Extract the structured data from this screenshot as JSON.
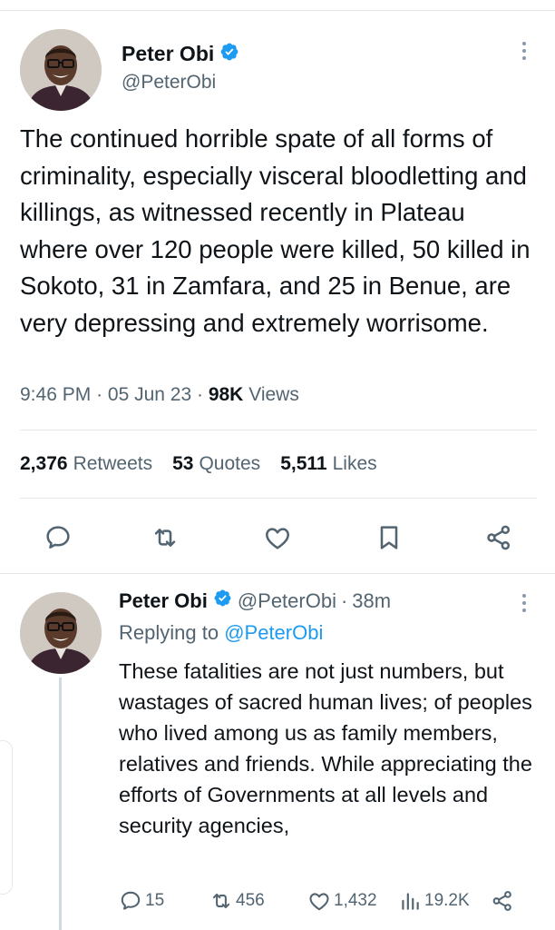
{
  "main_tweet": {
    "name": "Peter Obi",
    "handle": "@PeterObi",
    "text": "The continued horrible spate of all forms of criminality, especially visceral bloodletting and killings, as witnessed recently in Plateau where over 120 people were killed, 50 killed in Sokoto, 31 in Zamfara, and 25 in Benue, are very depressing and extremely worrisome.",
    "time": "9:46 PM",
    "date": "05 Jun 23",
    "views_count": "98K",
    "views_label": "Views",
    "retweets_count": "2,376",
    "retweets_label": "Retweets",
    "quotes_count": "53",
    "quotes_label": "Quotes",
    "likes_count": "5,511",
    "likes_label": "Likes"
  },
  "reply_tweet": {
    "name": "Peter Obi",
    "handle": "@PeterObi",
    "time_ago": "38m",
    "replying_prefix": "Replying to",
    "replying_to": "@PeterObi",
    "text": "These fatalities are not just numbers, but wastages of sacred human lives; of peoples who lived among us as family members, relatives and friends. While appreciating the efforts of Governments at all levels and security agencies,",
    "replies": "15",
    "retweets": "456",
    "likes": "1,432",
    "views": "19.2K"
  },
  "icons": {
    "verified": "verified-badge-icon",
    "reply": "comment-icon",
    "retweet": "retweet-icon",
    "like": "heart-icon",
    "bookmark": "bookmark-icon",
    "share": "share-icon",
    "views": "bar-chart-icon",
    "more": "more-vertical-icon"
  },
  "colors": {
    "accent": "#1d9bf0",
    "text": "#0f1419",
    "secondary": "#536471"
  }
}
